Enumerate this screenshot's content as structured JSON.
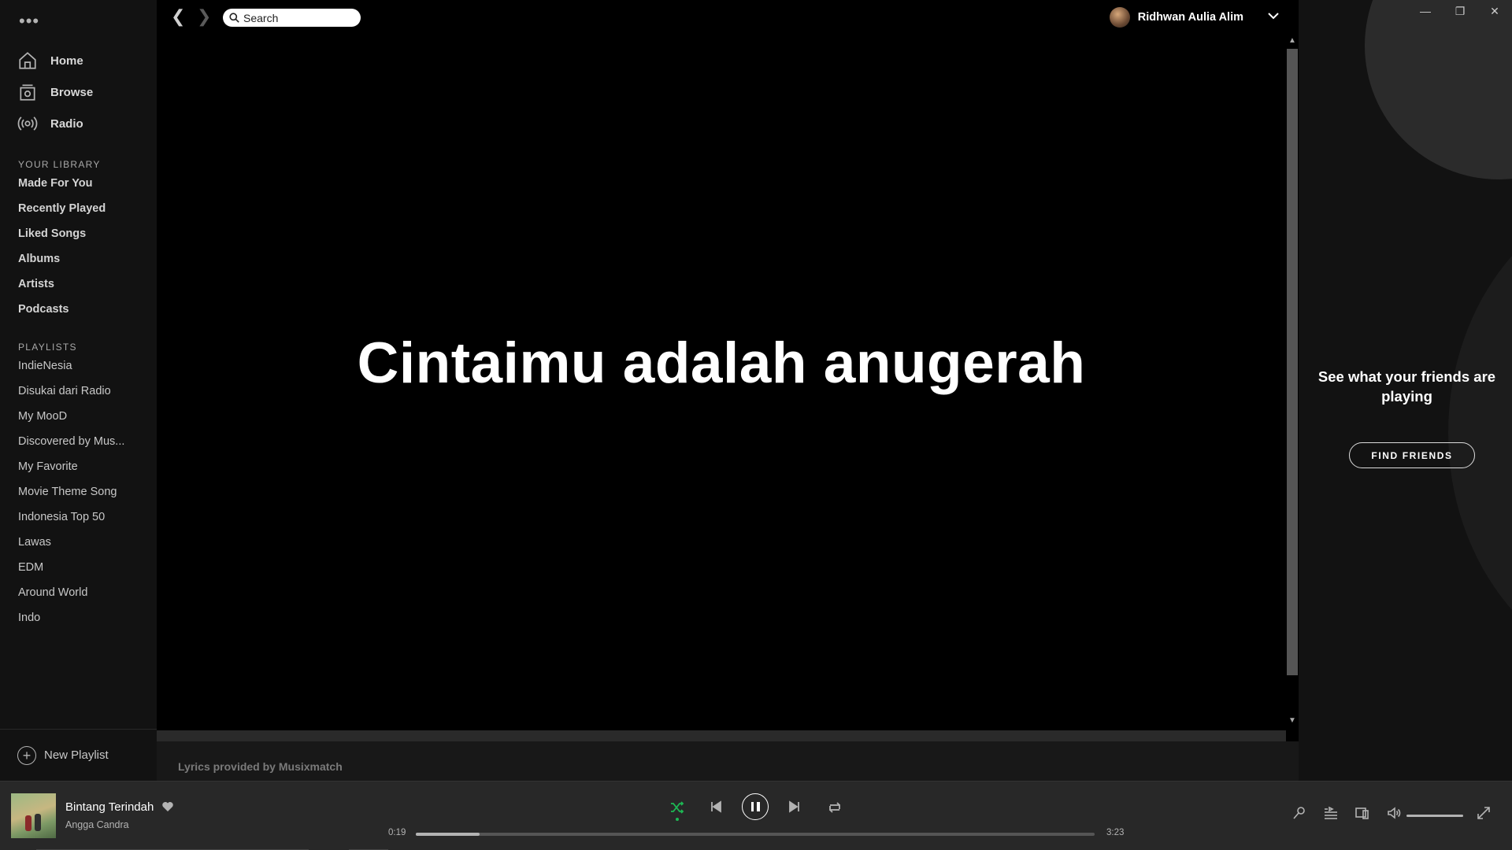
{
  "sidebar": {
    "nav": [
      {
        "label": "Home",
        "icon": "home-icon"
      },
      {
        "label": "Browse",
        "icon": "browse-icon"
      },
      {
        "label": "Radio",
        "icon": "radio-icon"
      }
    ],
    "library_title": "YOUR LIBRARY",
    "library": [
      "Made For You",
      "Recently Played",
      "Liked Songs",
      "Albums",
      "Artists",
      "Podcasts"
    ],
    "playlists_title": "PLAYLISTS",
    "playlists": [
      "IndieNesia",
      "Disukai dari Radio",
      "My MooD",
      "Discovered by Mus...",
      "My Favorite",
      "Movie Theme Song",
      "Indonesia Top 50",
      "Lawas",
      "EDM",
      "Around World",
      "Indo"
    ],
    "new_playlist": "New Playlist"
  },
  "topbar": {
    "search_placeholder": "Search",
    "user_name": "Ridhwan Aulia Alim"
  },
  "lyrics": {
    "current_line": "Cintaimu adalah anugerah",
    "provider": "Lyrics provided by Musixmatch"
  },
  "friends": {
    "title": "See what your friends are playing",
    "button": "FIND FRIENDS"
  },
  "player": {
    "track_title": "Bintang Terindah",
    "artist": "Angga Candra",
    "elapsed": "0:19",
    "duration": "3:23",
    "progress_fraction": 0.094,
    "volume_fraction": 1.0,
    "shuffle_on": true
  },
  "colors": {
    "accent": "#1db954",
    "sidebar_bg": "#121212",
    "player_bg": "#282828"
  }
}
